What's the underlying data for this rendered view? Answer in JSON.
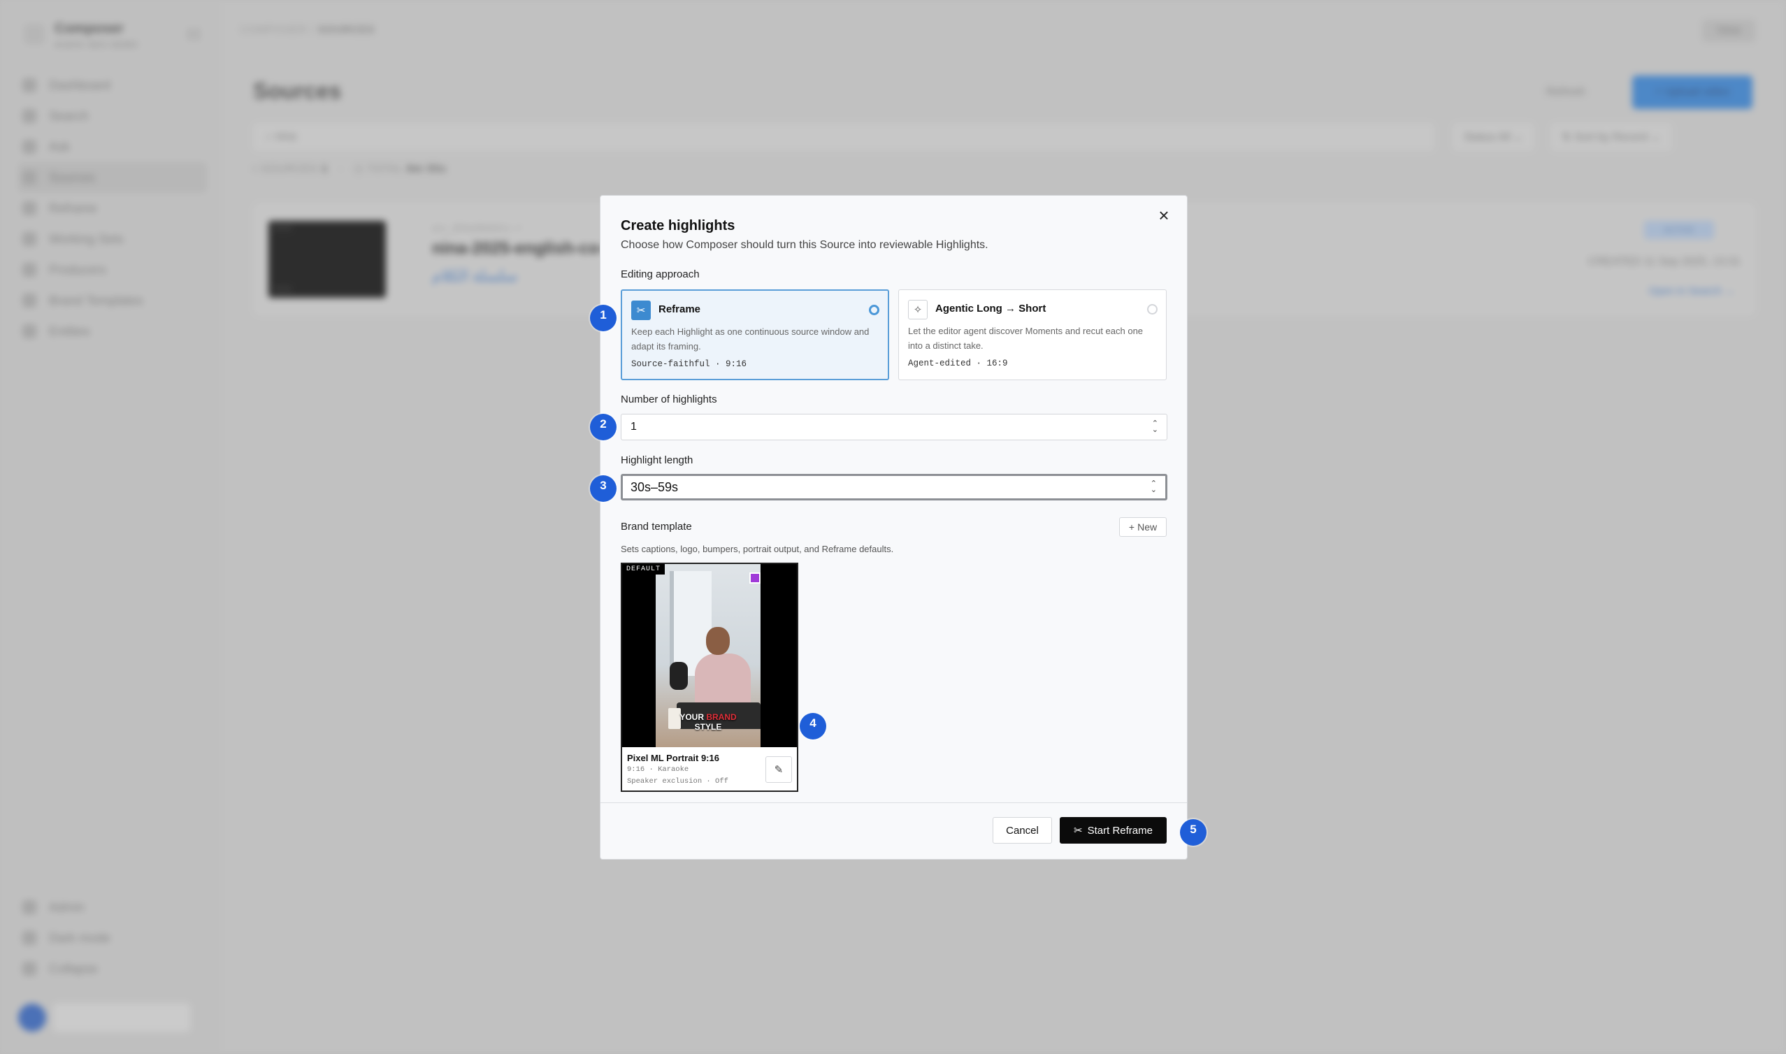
{
  "background": {
    "brand": {
      "name": "Composer",
      "subtitle": "AUDIO SEG DEMO"
    },
    "nav": [
      "Dashboard",
      "Search",
      "Ask",
      "Sources",
      "Reframe",
      "Working Sets",
      "Producers",
      "Brand Templates",
      "Entities"
    ],
    "nav_active_index": 3,
    "nav_bottom": [
      "Admin",
      "Dark mode",
      "Collapse"
    ],
    "breadcrumb": {
      "root": "COMPOSER",
      "sep": "/",
      "current": "SOURCES"
    },
    "top_button": "View",
    "page_title": "Sources",
    "refresh_label": "Refresh",
    "upload_label": "+ Upload video",
    "search_value": "⌕ nina",
    "status_filter": "Status  All ⌄",
    "sort_filter": "⇅ Sort by  Recent ⌄",
    "stats": {
      "sources_label": "SOURCES",
      "sources_count": "1",
      "total_label": "TOTAL",
      "total_value": "9m 55s"
    },
    "source": {
      "id": "src_8f4a9b6d1c  ✓",
      "title": "nina-2025-english-co-by-1",
      "subtitle": "سلسلة الكلام",
      "badge": "ACTIVE",
      "date": "CREATED  11 Sep 2025, 13:31",
      "link": "Open in Search →",
      "thumb_time_top": "00:00",
      "thumb_time_bottom": "09:55"
    }
  },
  "modal": {
    "title": "Create highlights",
    "description": "Choose how Composer should turn this Source into reviewable Highlights.",
    "editing_approach_label": "Editing approach",
    "options": [
      {
        "icon": "scissors-icon",
        "title": "Reframe",
        "description": "Keep each Highlight as one continuous source window and adapt its framing.",
        "meta": "Source-faithful · 9:16",
        "selected": true
      },
      {
        "icon": "sparkles-icon",
        "title": "Agentic Long → Short",
        "description": "Let the editor agent discover Moments and recut each one into a distinct take.",
        "meta": "Agent-edited · 16:9",
        "selected": false
      }
    ],
    "count_label": "Number of highlights",
    "count_value": "1",
    "length_label": "Highlight length",
    "length_value": "30s–59s",
    "brand_label": "Brand template",
    "new_button": "New",
    "brand_hint": "Sets captions, logo, bumpers, portrait output, and Reframe defaults.",
    "template": {
      "badge": "DEFAULT",
      "name": "Pixel ML Portrait 9:16",
      "meta_1": "9:16 · Karaoke",
      "meta_2": "Speaker exclusion · Off",
      "caption_line1_a": "YOUR ",
      "caption_line1_b": "BRAND",
      "caption_line2": "STYLE"
    },
    "cancel_label": "Cancel",
    "start_label": "Start Reframe",
    "close_glyph": "×"
  },
  "callouts": [
    "1",
    "2",
    "3",
    "4",
    "5"
  ],
  "colors": {
    "accent_blue": "#1f5ed8",
    "selected_border": "#5a9ed8",
    "primary_button": "#0b0b0b",
    "brand_red": "#e0303a"
  }
}
